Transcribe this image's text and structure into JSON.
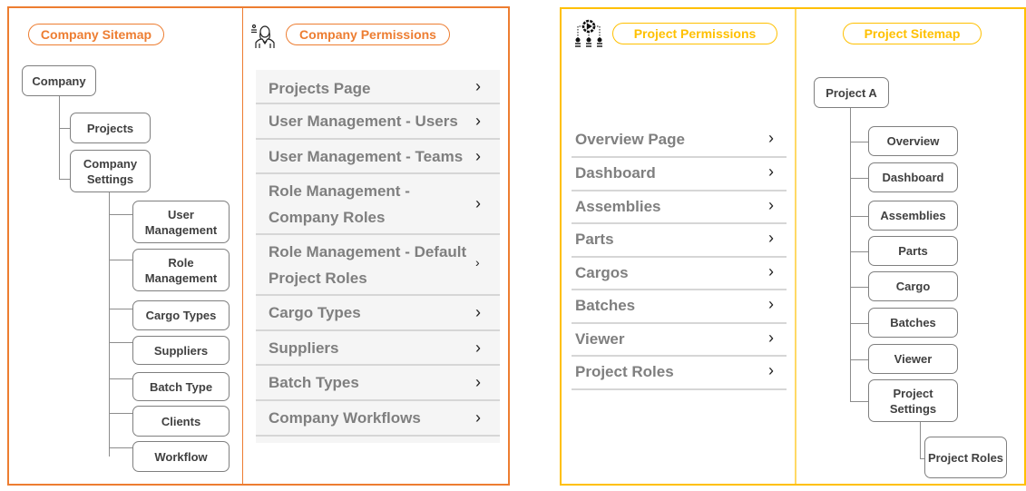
{
  "colors": {
    "company_accent": "#ed7d31",
    "project_accent": "#ffc000",
    "node_border": "#7f7f7f",
    "node_text": "#404040",
    "list_text": "#7f7f7f",
    "list_background": "#f5f5f5"
  },
  "company_sitemap": {
    "title": "Company Sitemap",
    "root": "Company",
    "level1": [
      "Projects",
      "Company Settings"
    ],
    "settings_children": [
      "User Management",
      "Role Management",
      "Cargo Types",
      "Suppliers",
      "Batch Type",
      "Clients",
      "Workflow"
    ]
  },
  "company_permissions": {
    "title": "Company Permissions",
    "icon": "employee-icon",
    "items": [
      {
        "label": "Projects Page"
      },
      {
        "label": "User Management - Users"
      },
      {
        "label": "User Management - Teams"
      },
      {
        "label": "Role Management - Company Roles",
        "line1": "Role Management -",
        "line2": "Company Roles"
      },
      {
        "label": "Role Management - Default Project Roles",
        "line1": "Role Management - Default",
        "line2": "Project Roles"
      },
      {
        "label": "Cargo Types"
      },
      {
        "label": "Suppliers"
      },
      {
        "label": "Batch Types"
      },
      {
        "label": "Company Workflows"
      }
    ],
    "chevron": "›"
  },
  "project_permissions": {
    "title": "Project Permissions",
    "icon": "workflow-gear-icon",
    "items": [
      "Overview Page",
      "Dashboard",
      "Assemblies",
      "Parts",
      "Cargos",
      "Batches",
      "Viewer",
      "Project Roles"
    ],
    "chevron": "›"
  },
  "project_sitemap": {
    "title": "Project Sitemap",
    "root": "Project A",
    "children": [
      "Overview",
      "Dashboard",
      "Assemblies",
      "Parts",
      "Cargo",
      "Batches",
      "Viewer",
      "Project Settings"
    ],
    "settings_children": [
      "Project Roles"
    ]
  }
}
